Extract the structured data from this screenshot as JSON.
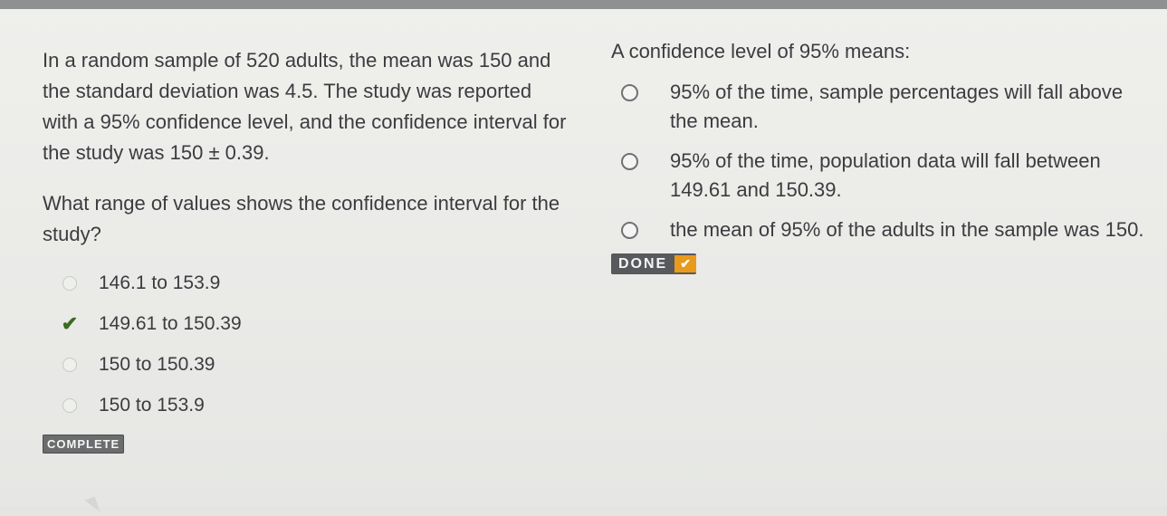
{
  "question1": {
    "prompt": "In a random sample of 520 adults, the mean was 150 and the standard deviation was 4.5. The study was reported with a 95% confidence level, and the confidence interval for the study was 150 ± 0.39.",
    "question": "What range of values shows the confidence interval for the study?",
    "options": [
      {
        "label": "146.1 to 153.9",
        "selected": false
      },
      {
        "label": "149.61 to 150.39",
        "selected": true
      },
      {
        "label": "150 to 150.39",
        "selected": false
      },
      {
        "label": "150 to 153.9",
        "selected": false
      }
    ],
    "status_badge": "COMPLETE"
  },
  "question2": {
    "prompt": "A confidence level of 95% means:",
    "options": [
      {
        "label": "95% of the time, sample percentages will fall above the mean."
      },
      {
        "label": "95% of the time, population data will fall between 149.61 and 150.39."
      },
      {
        "label": "the mean of 95% of the adults in the sample was 150."
      }
    ],
    "done_badge": "DONE",
    "done_icon": "check-icon"
  },
  "colors": {
    "background": "#e4e5e2",
    "text": "#3a3c3f",
    "check": "#3b6b1f",
    "done_accent": "#e89a1c",
    "badge_bg": "#58595c"
  }
}
